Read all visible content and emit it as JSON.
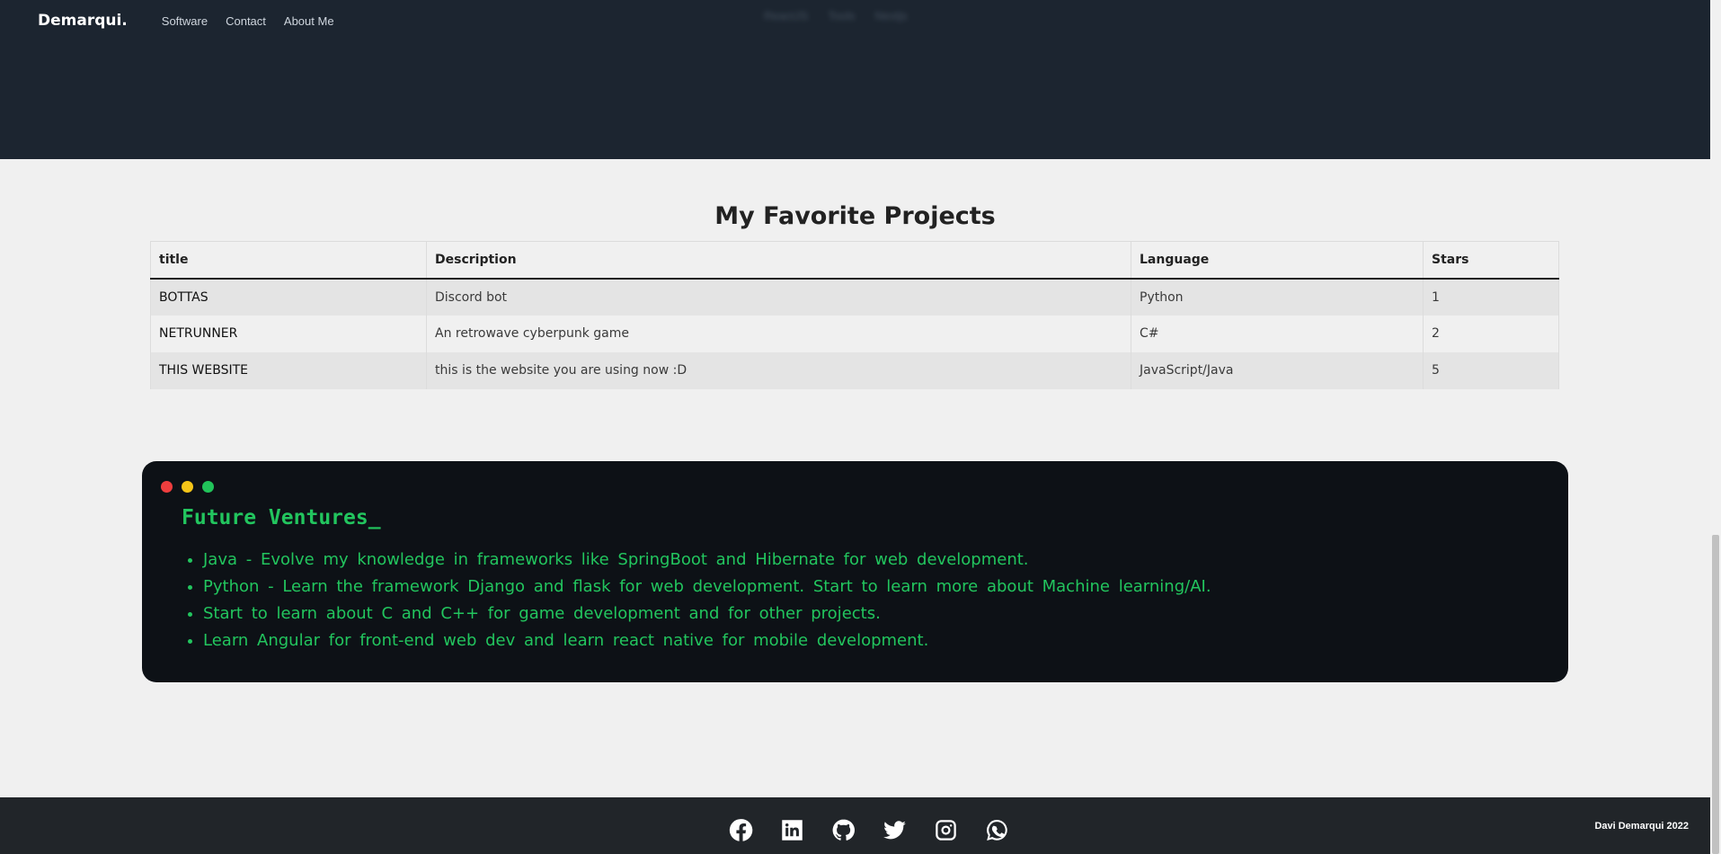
{
  "header": {
    "brand": "Demarqui.",
    "nav": [
      "Software",
      "Contact",
      "About Me"
    ],
    "blurred_tags": [
      "ReactJS",
      "Tools",
      "Nextjs"
    ]
  },
  "projects": {
    "title": "My Favorite Projects",
    "columns": [
      "title",
      "Description",
      "Language",
      "Stars"
    ],
    "rows": [
      [
        "BOTTAS",
        "Discord bot",
        "Python",
        "1"
      ],
      [
        "NETRUNNER",
        "An retrowave cyberpunk game",
        "C#",
        "2"
      ],
      [
        "THIS WEBSITE",
        "this is the website you are using now :D",
        "JavaScript/Java",
        "5"
      ]
    ]
  },
  "terminal": {
    "title": "Future Ventures_",
    "items": [
      "Java - Evolve my knowledge in frameworks like SpringBoot and Hibernate for web development.",
      "Python - Learn the framework Django and flask for web development. Start to learn more about Machine learning/AI.",
      "Start to learn about C and C++ for game development and for other projects.",
      "Learn Angular for front-end web dev and learn react native for mobile development."
    ],
    "colors": {
      "red": "#ee3e3e",
      "yellow": "#f5c518",
      "green": "#21c45a",
      "text": "#22c55e"
    }
  },
  "footer": {
    "icons": [
      "facebook-icon",
      "linkedin-icon",
      "github-icon",
      "twitter-icon",
      "instagram-icon",
      "whatsapp-icon"
    ],
    "copyright": "Davi Demarqui 2022"
  }
}
